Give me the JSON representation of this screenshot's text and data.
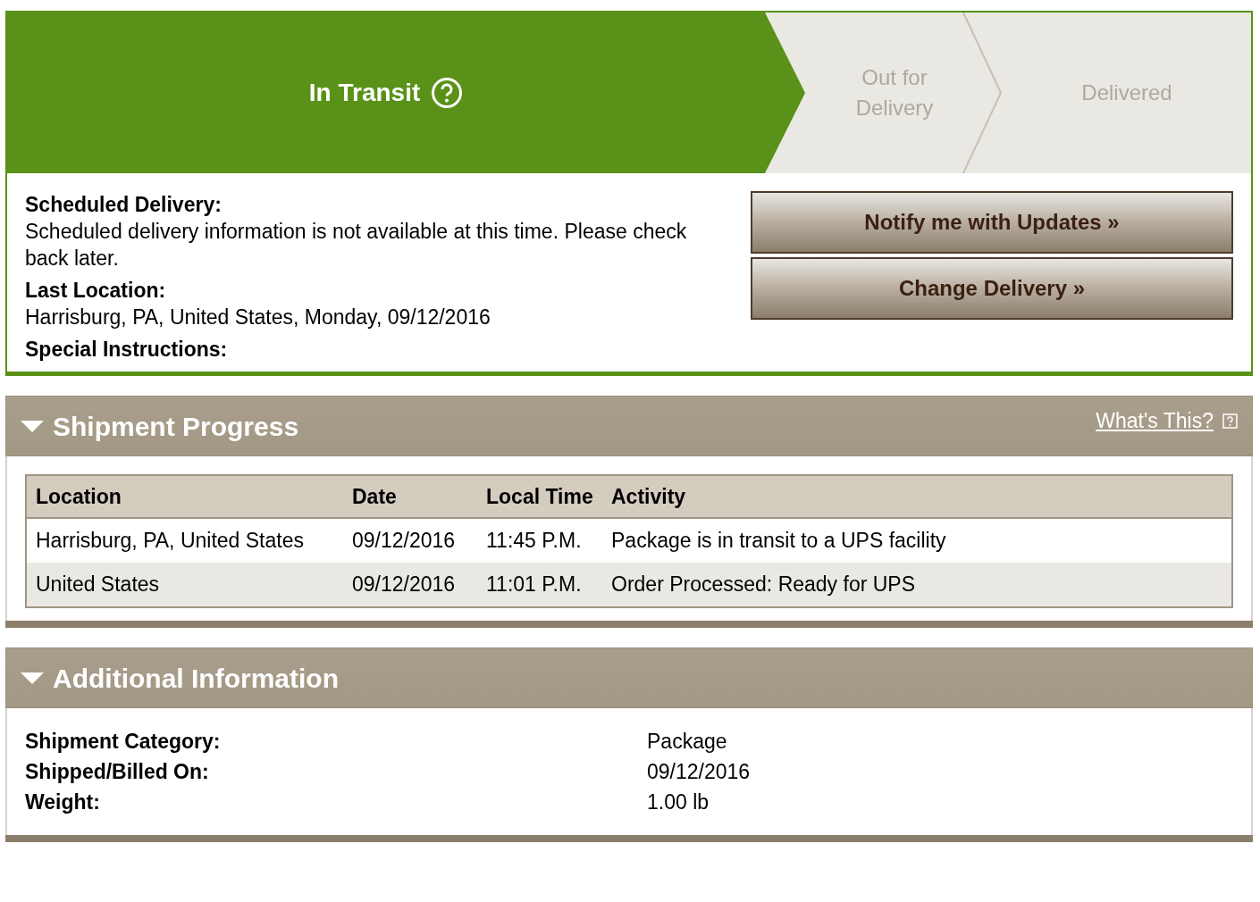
{
  "progress_steps": [
    {
      "label": "In Transit",
      "current": true
    },
    {
      "label": "Out for Delivery",
      "current": false
    },
    {
      "label": "Delivered",
      "current": false
    }
  ],
  "delivery_details": [
    {
      "label": "Scheduled Delivery:",
      "value": "Scheduled delivery information is not available at this time. Please check back later."
    },
    {
      "label": "Last Location:",
      "value": "Harrisburg, PA, United States, Monday, 09/12/2016"
    },
    {
      "label": "Special Instructions:"
    }
  ],
  "buttons": [
    "Notify me with Updates »",
    "Change Delivery »"
  ],
  "shipment_progress": {
    "title": "Shipment Progress",
    "expanded": true,
    "help_link": "What's This?",
    "table": {
      "columns": [
        "Location",
        "Date",
        "Local Time",
        "Activity"
      ],
      "rows": [
        [
          "Harrisburg, PA, United States",
          "09/12/2016",
          "11:45 P.M.",
          "Package is in transit to a UPS facility"
        ],
        [
          "United States",
          "09/12/2016",
          "11:01 P.M.",
          "Order Processed: Ready for UPS"
        ]
      ]
    }
  },
  "additional_information": {
    "title": "Additional Information",
    "expanded": true,
    "fields": [
      {
        "label": "Shipment Category:",
        "value": "Package"
      },
      {
        "label": "Shipped/Billed On:",
        "value": "09/12/2016"
      },
      {
        "label": "Weight:",
        "value": "1.00 lb"
      }
    ]
  }
}
